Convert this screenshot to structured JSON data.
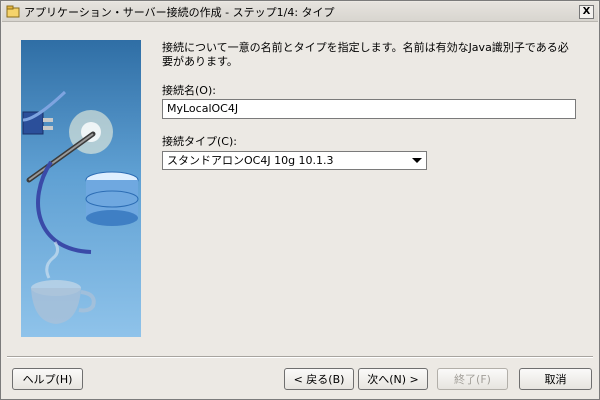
{
  "window": {
    "title": "アプリケーション・サーバー接続の作成 - ステップ1/4: タイプ",
    "close_label": "X"
  },
  "form": {
    "description": "接続について一意の名前とタイプを指定します。名前は有効なJava識別子である必要があります。",
    "name_label": "接続名(O):",
    "name_value": "MyLocalOC4J",
    "type_label": "接続タイプ(C):",
    "type_value": "スタンドアロンOC4J 10g 10.1.3"
  },
  "buttons": {
    "help": "ヘルプ(H)",
    "back": "< 戻る(B)",
    "next": "次へ(N) >",
    "finish": "終了(F)",
    "cancel": "取消"
  },
  "icons": {
    "app": "oracle-jdeveloper-icon",
    "close": "close-icon",
    "dropdown": "chevron-down-icon",
    "illustration": "wizard-illustration"
  }
}
